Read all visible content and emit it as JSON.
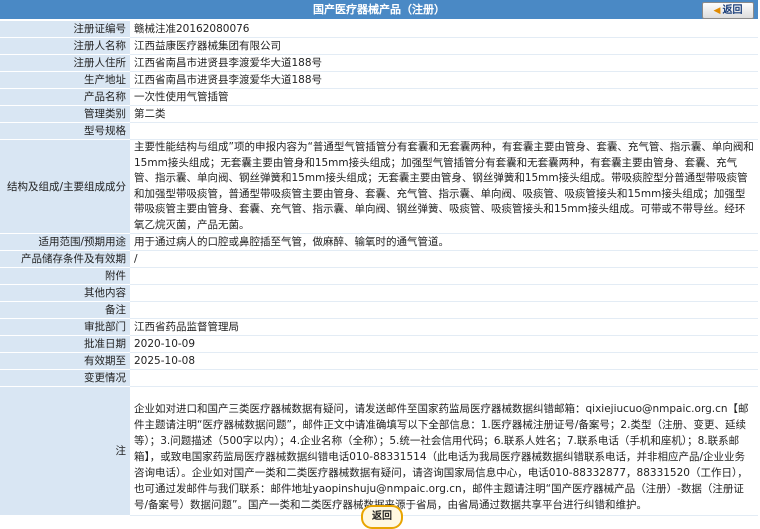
{
  "header": {
    "title": "国产医疗器械产品（注册）",
    "back_label": "返回"
  },
  "rows": [
    {
      "label": "注册证编号",
      "value": "赣械注准20162080076"
    },
    {
      "label": "注册人名称",
      "value": "江西益康医疗器械集团有限公司"
    },
    {
      "label": "注册人住所",
      "value": "江西省南昌市进贤县李渡爱华大道188号"
    },
    {
      "label": "生产地址",
      "value": "江西省南昌市进贤县李渡爱华大道188号"
    },
    {
      "label": "产品名称",
      "value": "一次性使用气管插管"
    },
    {
      "label": "管理类别",
      "value": "第二类"
    },
    {
      "label": "型号规格",
      "value": ""
    },
    {
      "label": "结构及组成/主要组成成分",
      "value": "主要性能结构与组成”项的申报内容为“普通型气管插管分有套囊和无套囊两种，有套囊主要由管身、套囊、充气管、指示囊、单向阀和15mm接头组成；无套囊主要由管身和15mm接头组成；加强型气管插管分有套囊和无套囊两种，有套囊主要由管身、套囊、充气管、指示囊、单向阀、钢丝弹簧和15mm接头组成；无套囊主要由管身、钢丝弹簧和15mm接头组成。带吸痰腔型分普通型带吸痰管和加强型带吸痰管，普通型带吸痰管主要由管身、套囊、充气管、指示囊、单向阀、吸痰管、吸痰管接头和15mm接头组成；加强型带吸痰管主要由管身、套囊、充气管、指示囊、单向阀、钢丝弹簧、吸痰管、吸痰管接头和15mm接头组成。可带或不带导丝。经环氧乙烷灭菌，产品无菌。"
    },
    {
      "label": "适用范围/预期用途",
      "value": "用于通过病人的口腔或鼻腔插至气管，做麻醉、输氧时的通气管道。"
    },
    {
      "label": "产品储存条件及有效期",
      "value": "/"
    },
    {
      "label": "附件",
      "value": ""
    },
    {
      "label": "其他内容",
      "value": ""
    },
    {
      "label": "备注",
      "value": ""
    },
    {
      "label": "审批部门",
      "value": "江西省药品监督管理局"
    },
    {
      "label": "批准日期",
      "value": "2020-10-09"
    },
    {
      "label": "有效期至",
      "value": "2025-10-08"
    },
    {
      "label": "变更情况",
      "value": ""
    }
  ],
  "notice": {
    "label": "注",
    "text": "企业如对进口和国产三类医疗器械数据有疑问，请发送邮件至国家药监局医疗器械数据纠错邮箱：qixiejiucuo@nmpaic.org.cn【邮件主题请注明“医疗器械数据问题”，邮件正文中请准确填写以下全部信息：1.医疗器械注册证号/备案号；2.类型（注册、变更、延续等）；3.问题描述（500字以内）；4.企业名称（全称）；5.统一社会信用代码；6.联系人姓名；7.联系电话（手机和座机）；8.联系邮箱】，或致电国家药监局医疗器械数据纠错电话010-88331514（此电话为我局医疗器械数据纠错联系电话，并非相应产品/企业业务咨询电话）。企业如对国产一类和二类医疗器械数据有疑问，请咨询国家局信息中心，电话010-88332877，88331520（工作日），也可通过发邮件与我们联系：邮件地址yaopinshuju@nmpaic.org.cn，邮件主题请注明“国产医疗器械产品（注册）-数据（注册证号/备案号）数据问题”。国产一类和二类医疗器械数据来源于省局，由省局通过数据共享平台进行纠错和维护。"
  },
  "footer": {
    "back_label": "返回"
  }
}
